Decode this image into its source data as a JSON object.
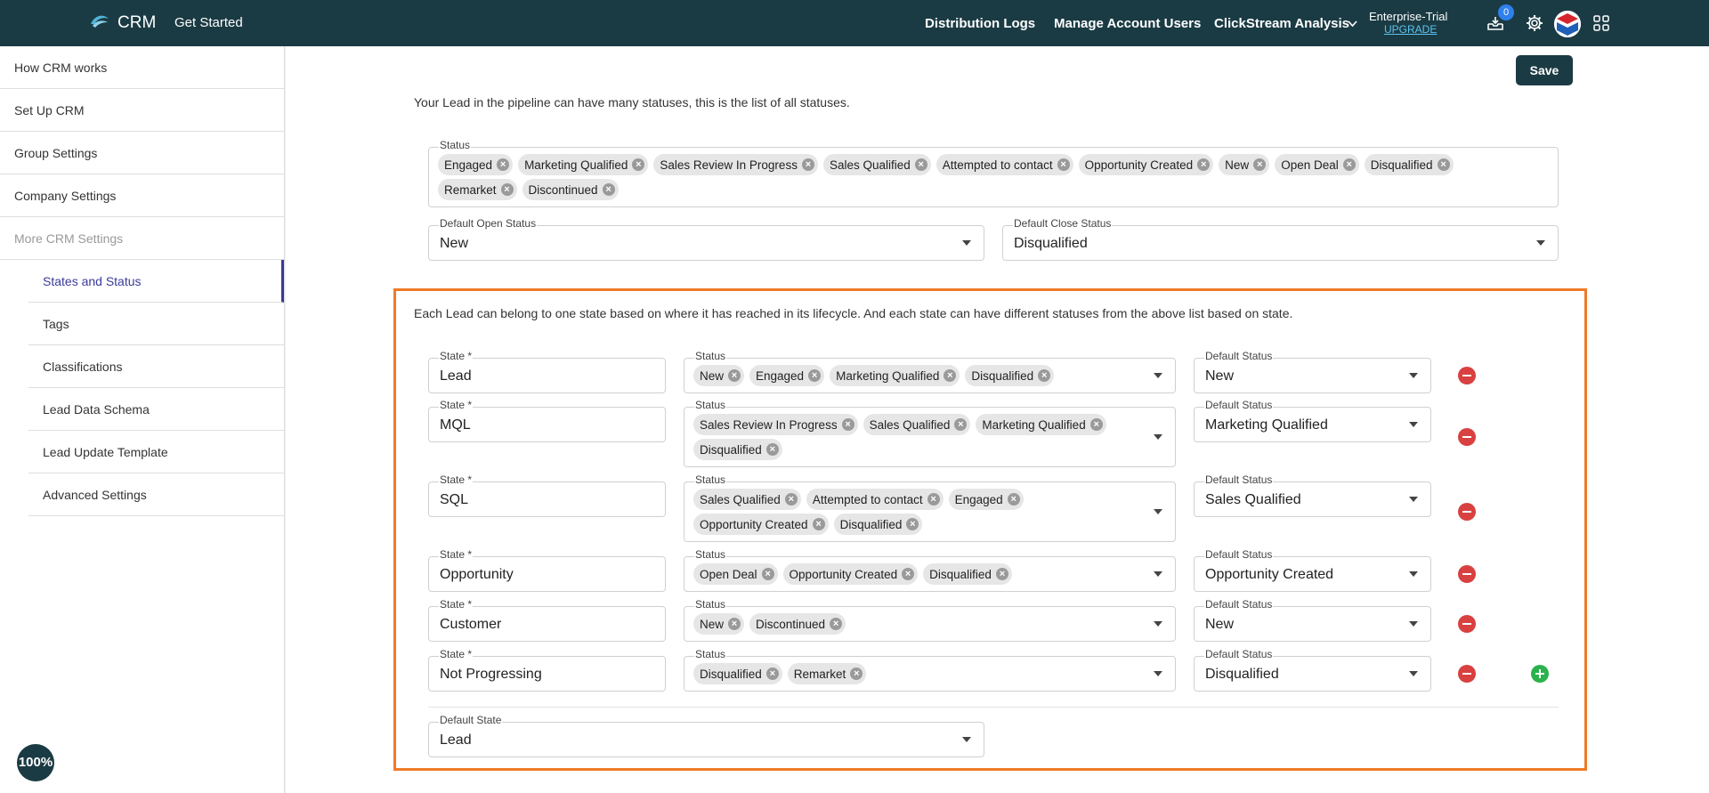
{
  "topbar": {
    "brand": "CRM",
    "get_started": "Get Started",
    "nav": [
      "Distribution Logs",
      "Manage Account Users",
      "ClickStream Analysis"
    ],
    "plan": "Enterprise-Trial",
    "upgrade": "UPGRADE",
    "notification_count": "0"
  },
  "sidebar": {
    "items": [
      "How CRM works",
      "Set Up CRM",
      "Group Settings",
      "Company Settings",
      "More CRM Settings"
    ],
    "sub_items": [
      "States and Status",
      "Tags",
      "Classifications",
      "Lead Data Schema",
      "Lead Update Template",
      "Advanced Settings"
    ]
  },
  "main": {
    "save_label": "Save",
    "statuses_intro": "Your Lead in the pipeline can have many statuses, this is the list of all statuses.",
    "status_label": "Status",
    "all_statuses": [
      "Engaged",
      "Marketing Qualified",
      "Sales Review In Progress",
      "Sales Qualified",
      "Attempted to contact",
      "Opportunity Created",
      "New",
      "Open Deal",
      "Disqualified",
      "Remarket",
      "Discontinued"
    ],
    "default_open_label": "Default Open Status",
    "default_open_value": "New",
    "default_close_label": "Default Close Status",
    "default_close_value": "Disqualified",
    "states_intro": "Each Lead can belong to one state based on where it has reached in its lifecycle. And each state can have different statuses from the above list based on state.",
    "state_label": "State *",
    "row_status_label": "Status",
    "default_status_label": "Default Status",
    "states": [
      {
        "state": "Lead",
        "statuses": [
          "New",
          "Engaged",
          "Marketing Qualified",
          "Disqualified"
        ],
        "default": "New"
      },
      {
        "state": "MQL",
        "statuses": [
          "Sales Review In Progress",
          "Sales Qualified",
          "Marketing Qualified",
          "Disqualified"
        ],
        "default": "Marketing Qualified"
      },
      {
        "state": "SQL",
        "statuses": [
          "Sales Qualified",
          "Attempted to contact",
          "Engaged",
          "Opportunity Created",
          "Disqualified"
        ],
        "default": "Sales Qualified"
      },
      {
        "state": "Opportunity",
        "statuses": [
          "Open Deal",
          "Opportunity Created",
          "Disqualified"
        ],
        "default": "Opportunity Created"
      },
      {
        "state": "Customer",
        "statuses": [
          "New",
          "Discontinued"
        ],
        "default": "New"
      },
      {
        "state": "Not Progressing",
        "statuses": [
          "Disqualified",
          "Remarket"
        ],
        "default": "Disqualified"
      }
    ],
    "default_state_label": "Default State",
    "default_state_value": "Lead"
  },
  "zoom": "100%",
  "colors": {
    "topbar": "#1b3b44",
    "highlight": "#ef7a27",
    "remove": "#d94040",
    "add": "#2bb24c",
    "active_nav": "#3a3a9a"
  }
}
